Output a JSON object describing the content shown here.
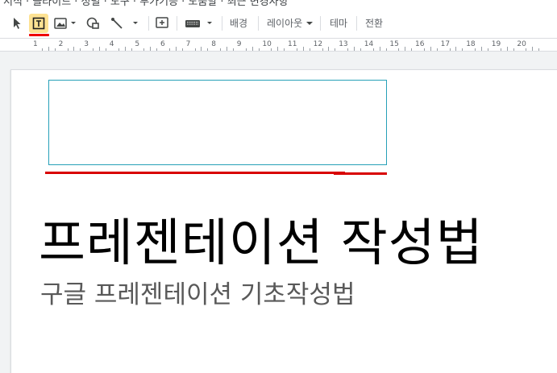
{
  "menu_strip": {
    "cut_text": "서식 · 슬라이드 · 정렬 · 도구 · 부가기능 · 도움말 · 최근 변경사항"
  },
  "toolbar": {
    "icons": [
      "select-icon",
      "textbox-icon",
      "image-icon",
      "shape-icon",
      "line-icon",
      "comment-icon",
      "keyboard-icon"
    ],
    "background_label": "배경",
    "layout_label": "레이아웃",
    "theme_label": "테마",
    "transition_label": "전환"
  },
  "ruler": {
    "marks": [
      "1",
      "2",
      "3",
      "4",
      "5",
      "6",
      "7",
      "8",
      "9",
      "10",
      "11",
      "12",
      "13",
      "14",
      "15",
      "16",
      "17",
      "18",
      "19",
      "20"
    ]
  },
  "slide": {
    "title": "프레젠테이션 작성법",
    "subtitle": "구글 프레젠테이션 기초작성법"
  },
  "colors": {
    "active_tool": "#fde293",
    "annotation_red": "#d80000",
    "selection_border": "#26a0b8"
  }
}
